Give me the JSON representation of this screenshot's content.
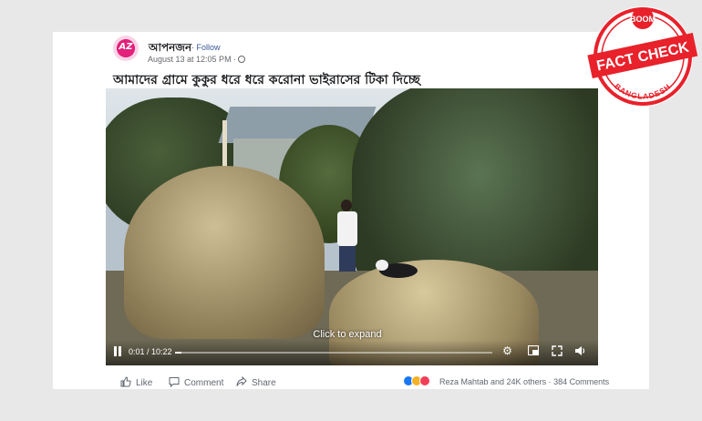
{
  "post": {
    "page_name": "আপনজন",
    "follow_label": "Follow",
    "dot_separator": "·",
    "timestamp": "August 13 at 12:05 PM ·",
    "avatar_text": "AZ",
    "more_label": "•••",
    "caption": "আমাদের গ্রামে কুকুর ধরে ধরে করোনা ভাইরাসের টিকা দিচ্ছে"
  },
  "video": {
    "expand_label": "Click to expand",
    "time": "0:01 / 10:22",
    "progress": 0.002
  },
  "actions": {
    "like": "Like",
    "comment": "Comment",
    "share": "Share"
  },
  "reactions": {
    "summary": "Reza Mahtab and 24K others",
    "comments": "384 Comments"
  },
  "stamp": {
    "top_text": "BOOM",
    "main_text": "FACT CHECK",
    "bottom_text": "BANGLADESH",
    "color": "#e8212b"
  }
}
